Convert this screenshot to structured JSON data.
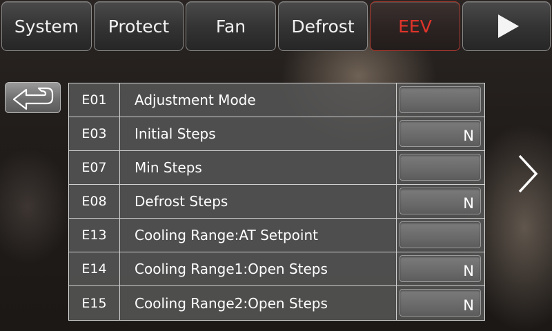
{
  "tabs": [
    {
      "label": "System",
      "active": false
    },
    {
      "label": "Protect",
      "active": false
    },
    {
      "label": "Fan",
      "active": false
    },
    {
      "label": "Defrost",
      "active": false
    },
    {
      "label": "EEV",
      "active": true
    }
  ],
  "icons": {
    "back": "back-arrow-icon",
    "next_tab": "play-icon",
    "next_page": "chevron-right-icon"
  },
  "colors": {
    "active_tab_text": "#e0342a",
    "text": "#ffffff"
  },
  "params": [
    {
      "code": "E01",
      "name": "Adjustment Mode",
      "value": ""
    },
    {
      "code": "E03",
      "name": "Initial Steps",
      "value": "N"
    },
    {
      "code": "E07",
      "name": "Min Steps",
      "value": ""
    },
    {
      "code": "E08",
      "name": "Defrost Steps",
      "value": "N"
    },
    {
      "code": "E13",
      "name": "Cooling Range:AT Setpoint",
      "value": ""
    },
    {
      "code": "E14",
      "name": "Cooling Range1:Open Steps",
      "value": "N"
    },
    {
      "code": "E15",
      "name": "Cooling Range2:Open Steps",
      "value": "N"
    }
  ]
}
